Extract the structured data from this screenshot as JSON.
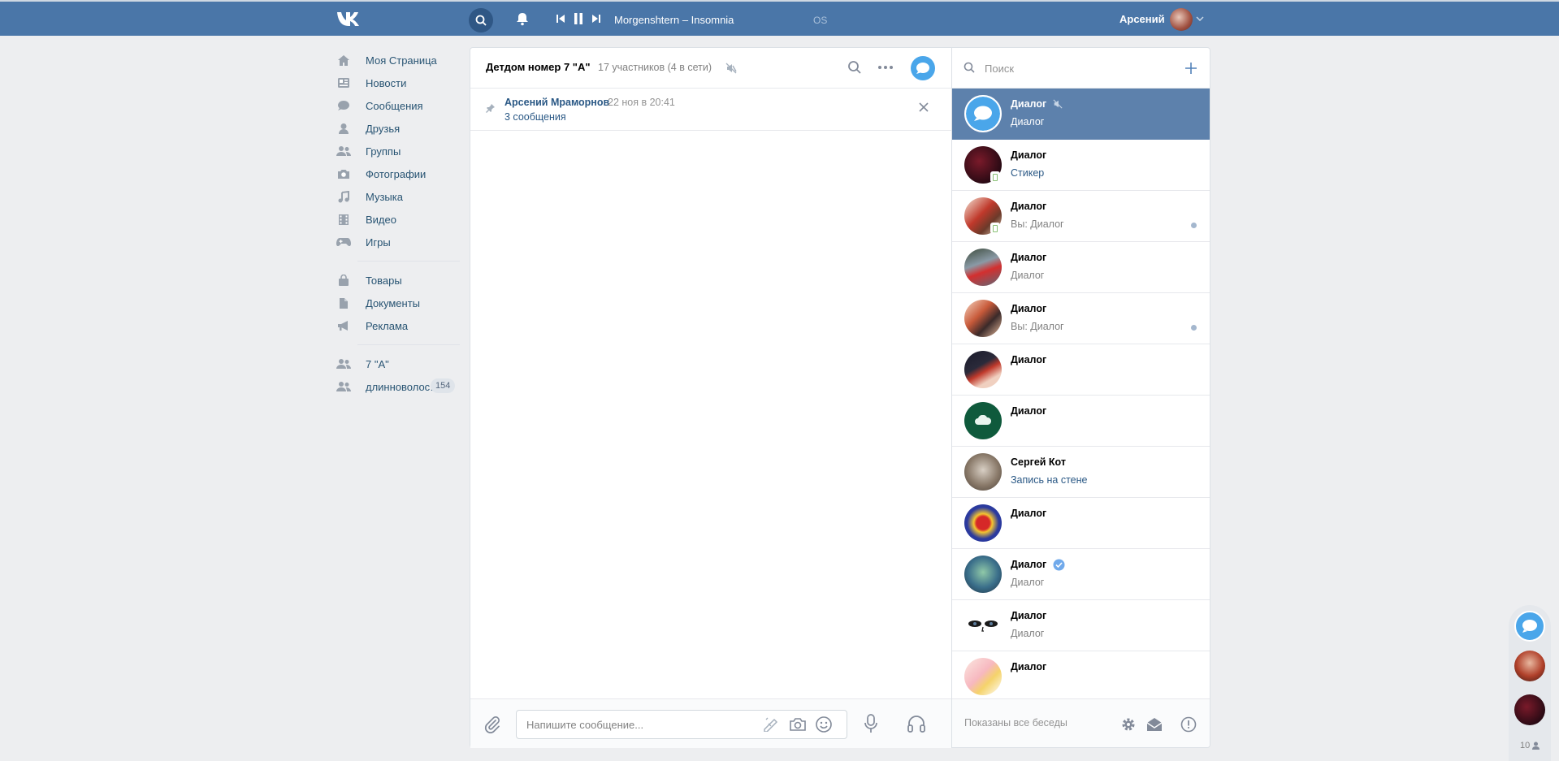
{
  "header": {
    "logo": "vk-logo",
    "track": "Morgenshtern – Insomnia",
    "track_extra": "OS",
    "user_name": "Арсений"
  },
  "nav": {
    "items": [
      {
        "label": "Моя Страница",
        "icon": "home-icon"
      },
      {
        "label": "Новости",
        "icon": "news-icon"
      },
      {
        "label": "Сообщения",
        "icon": "messages-icon"
      },
      {
        "label": "Друзья",
        "icon": "friends-icon"
      },
      {
        "label": "Группы",
        "icon": "groups-icon"
      },
      {
        "label": "Фотографии",
        "icon": "camera-icon"
      },
      {
        "label": "Музыка",
        "icon": "music-icon"
      },
      {
        "label": "Видео",
        "icon": "video-icon"
      },
      {
        "label": "Игры",
        "icon": "games-icon"
      }
    ],
    "items2": [
      {
        "label": "Товары",
        "icon": "bag-icon"
      },
      {
        "label": "Документы",
        "icon": "document-icon"
      },
      {
        "label": "Реклама",
        "icon": "ads-icon"
      }
    ],
    "items3": [
      {
        "label": "7 \"А\"",
        "icon": "group-icon"
      },
      {
        "label": "длинноволос…",
        "icon": "group-icon",
        "count": "154"
      }
    ]
  },
  "chat": {
    "title": "Детдом номер 7 \"А\"",
    "subtitle": "17 участников (4 в сети)",
    "pinned_author": "Арсений Мраморнов",
    "pinned_date": "22 ноя в 20:41",
    "pinned_count": "3 сообщения",
    "composer_placeholder": "Напишите сообщение..."
  },
  "dialogs": {
    "search_placeholder": "Поиск",
    "footer_text": "Показаны все беседы",
    "items": [
      {
        "name": "Диалог",
        "preview": "Диалог",
        "active": true,
        "muted": true
      },
      {
        "name": "Диалог",
        "preview": "Стикер",
        "preview_link": true,
        "online_mobile": true
      },
      {
        "name": "Диалог",
        "preview": "Вы: Диалог",
        "online_mobile": true,
        "unread": true
      },
      {
        "name": "Диалог",
        "preview": "Диалог"
      },
      {
        "name": "Диалог",
        "preview": "Вы: Диалог",
        "unread": true
      },
      {
        "name": "Диалог",
        "preview": ""
      },
      {
        "name": "Диалог",
        "preview": ""
      },
      {
        "name": "Сергей Кот",
        "preview": "Запись на стене",
        "preview_link": true
      },
      {
        "name": "Диалог",
        "preview": ""
      },
      {
        "name": "Диалог",
        "preview": "Диалог",
        "verified": true
      },
      {
        "name": "Диалог",
        "preview": "Диалог"
      },
      {
        "name": "Диалог",
        "preview": ""
      }
    ]
  },
  "minibar": {
    "online_count": "10"
  },
  "colors": {
    "header": "#4a76a8",
    "accent": "#4aa6ea",
    "active_dialog": "#5d81ac",
    "link": "#2a5885"
  }
}
